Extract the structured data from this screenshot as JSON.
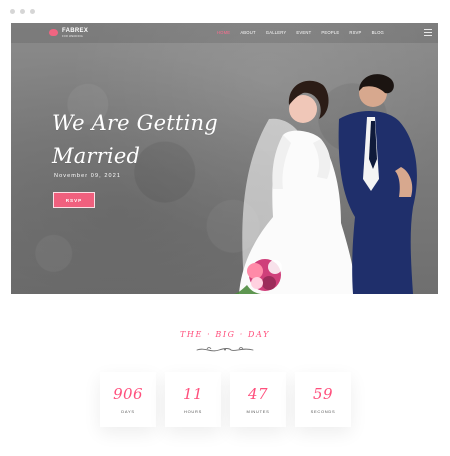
{
  "brand": {
    "name": "FABREX",
    "tagline": "FOR WEDDING",
    "accent": "#f0607e"
  },
  "nav": {
    "items": [
      {
        "label": "HOME",
        "active": true
      },
      {
        "label": "ABOUT",
        "active": false
      },
      {
        "label": "GALLERY",
        "active": false
      },
      {
        "label": "EVENT",
        "active": false
      },
      {
        "label": "PEOPLE",
        "active": false
      },
      {
        "label": "RSVP",
        "active": false
      },
      {
        "label": "BLOG",
        "active": false
      }
    ],
    "menu_icon": "hamburger-icon"
  },
  "hero": {
    "headline_line1": "We Are Getting",
    "headline_line2": "Married",
    "date": "November 09, 2021",
    "cta_label": "RSVP"
  },
  "section": {
    "title": "THE · BIG · DAY",
    "ornament_icon": "floral-divider-icon"
  },
  "countdown": [
    {
      "value": "906",
      "label": "DAYS"
    },
    {
      "value": "11",
      "label": "HOURS"
    },
    {
      "value": "47",
      "label": "MINUTES"
    },
    {
      "value": "59",
      "label": "SECONDS"
    }
  ]
}
